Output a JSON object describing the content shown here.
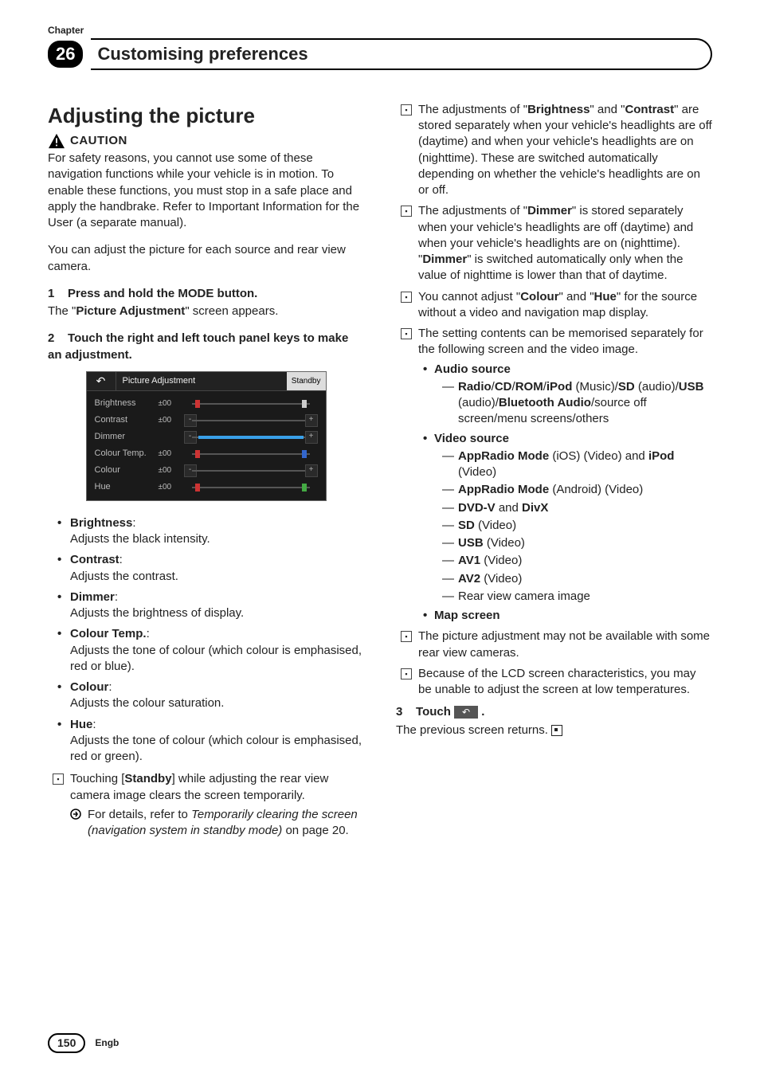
{
  "header": {
    "chapter_label": "Chapter",
    "chapter_number": "26",
    "section_title": "Customising preferences"
  },
  "left": {
    "h1": "Adjusting the picture",
    "caution": "CAUTION",
    "safety": "For safety reasons, you cannot use some of these navigation functions while your vehicle is in motion. To enable these functions, you must stop in a safe place and apply the handbrake. Refer to Important Information for the User (a separate manual).",
    "intro": "You can adjust the picture for each source and rear view camera.",
    "step1": {
      "num": "1",
      "title": "Press and hold the MODE button."
    },
    "step1_sub_a": "The \"",
    "step1_sub_b": "Picture Adjustment",
    "step1_sub_c": "\" screen appears.",
    "step2": {
      "num": "2",
      "title": "Touch the right and left touch panel keys to make an adjustment."
    },
    "screenshot": {
      "title": "Picture Adjustment",
      "standby": "Standby",
      "rows": [
        {
          "label": "Brightness",
          "val": "±00"
        },
        {
          "label": "Contrast",
          "val": "±00"
        },
        {
          "label": "Dimmer",
          "val": ""
        },
        {
          "label": "Colour Temp.",
          "val": "±00"
        },
        {
          "label": "Colour",
          "val": "±00"
        },
        {
          "label": "Hue",
          "val": "±00"
        }
      ]
    },
    "items": [
      {
        "t": "Brightness",
        "d": "Adjusts the black intensity."
      },
      {
        "t": "Contrast",
        "d": "Adjusts the contrast."
      },
      {
        "t": "Dimmer",
        "d": "Adjusts the brightness of display."
      },
      {
        "t": "Colour Temp.",
        "d": "Adjusts the tone of colour (which colour is emphasised, red or blue)."
      },
      {
        "t": "Colour",
        "d": "Adjusts the colour saturation."
      },
      {
        "t": "Hue",
        "d": "Adjusts the tone of colour (which colour is emphasised, red or green)."
      }
    ],
    "note_standby_a": "Touching [",
    "note_standby_b": "Standby",
    "note_standby_c": "] while adjusting the rear view camera image clears the screen temporarily.",
    "ref_a": "For details, refer to ",
    "ref_i": "Temporarily clearing the screen (navigation system in standby mode)",
    "ref_b": " on page 20."
  },
  "right": {
    "note_bc_a": "The adjustments of \"",
    "note_bc_b": "Brightness",
    "note_bc_c": "\" and \"",
    "note_bc_d": "Contrast",
    "note_bc_e": "\" are stored separately when your vehicle's headlights are off (daytime) and when your vehicle's headlights are on (nighttime). These are switched automatically depending on whether the vehicle's headlights are on or off.",
    "note_dim_a": "The adjustments of \"",
    "note_dim_b": "Dimmer",
    "note_dim_c": "\" is stored separately when your vehicle's headlights are off (daytime) and when your vehicle's headlights are on (nighttime). \"",
    "note_dim_d": "Dimmer",
    "note_dim_e": "\" is switched automatically only when the value of nighttime is lower than that of daytime.",
    "note_ch_a": "You cannot adjust \"",
    "note_ch_b": "Colour",
    "note_ch_c": "\" and \"",
    "note_ch_d": "Hue",
    "note_ch_e": "\" for the source without a video and navigation map display.",
    "note_mem": "The setting contents can be memorised separately for the following screen and the video image.",
    "audio_source": "Audio source",
    "audio_line_a": "Radio",
    "audio_line_b": "CD",
    "audio_line_c": "ROM",
    "audio_line_d": "iPod",
    "audio_line_e": " (Music)/",
    "audio_line_f": "SD",
    "audio_line_g": " (audio)/",
    "audio_line_h": "USB",
    "audio_line_i": " (audio)/",
    "audio_line_j": "Bluetooth Audio",
    "audio_line_k": "/source off screen/menu screens/others",
    "video_source": "Video source",
    "video": {
      "l1a": "AppRadio Mode",
      "l1b": " (iOS) (Video) and ",
      "l1c": "iPod",
      "l1d": " (Video)",
      "l2a": "AppRadio Mode",
      "l2b": " (Android) (Video)",
      "l3a": "DVD-V",
      "l3b": " and ",
      "l3c": "DivX",
      "l4a": "SD",
      "l4b": " (Video)",
      "l5a": "USB",
      "l5b": " (Video)",
      "l6a": "AV1",
      "l6b": " (Video)",
      "l7a": "AV2",
      "l7b": " (Video)",
      "l8": "Rear view camera image"
    },
    "map_screen": "Map screen",
    "note_rvc": "The picture adjustment may not be available with some rear view cameras.",
    "note_lcd": "Because of the LCD screen characteristics, you may be unable to adjust the screen at low temperatures.",
    "step3": {
      "num": "3",
      "title_a": "Touch ",
      "title_b": "."
    },
    "step3_sub": "The previous screen returns."
  },
  "footer": {
    "page": "150",
    "lang": "Engb"
  }
}
